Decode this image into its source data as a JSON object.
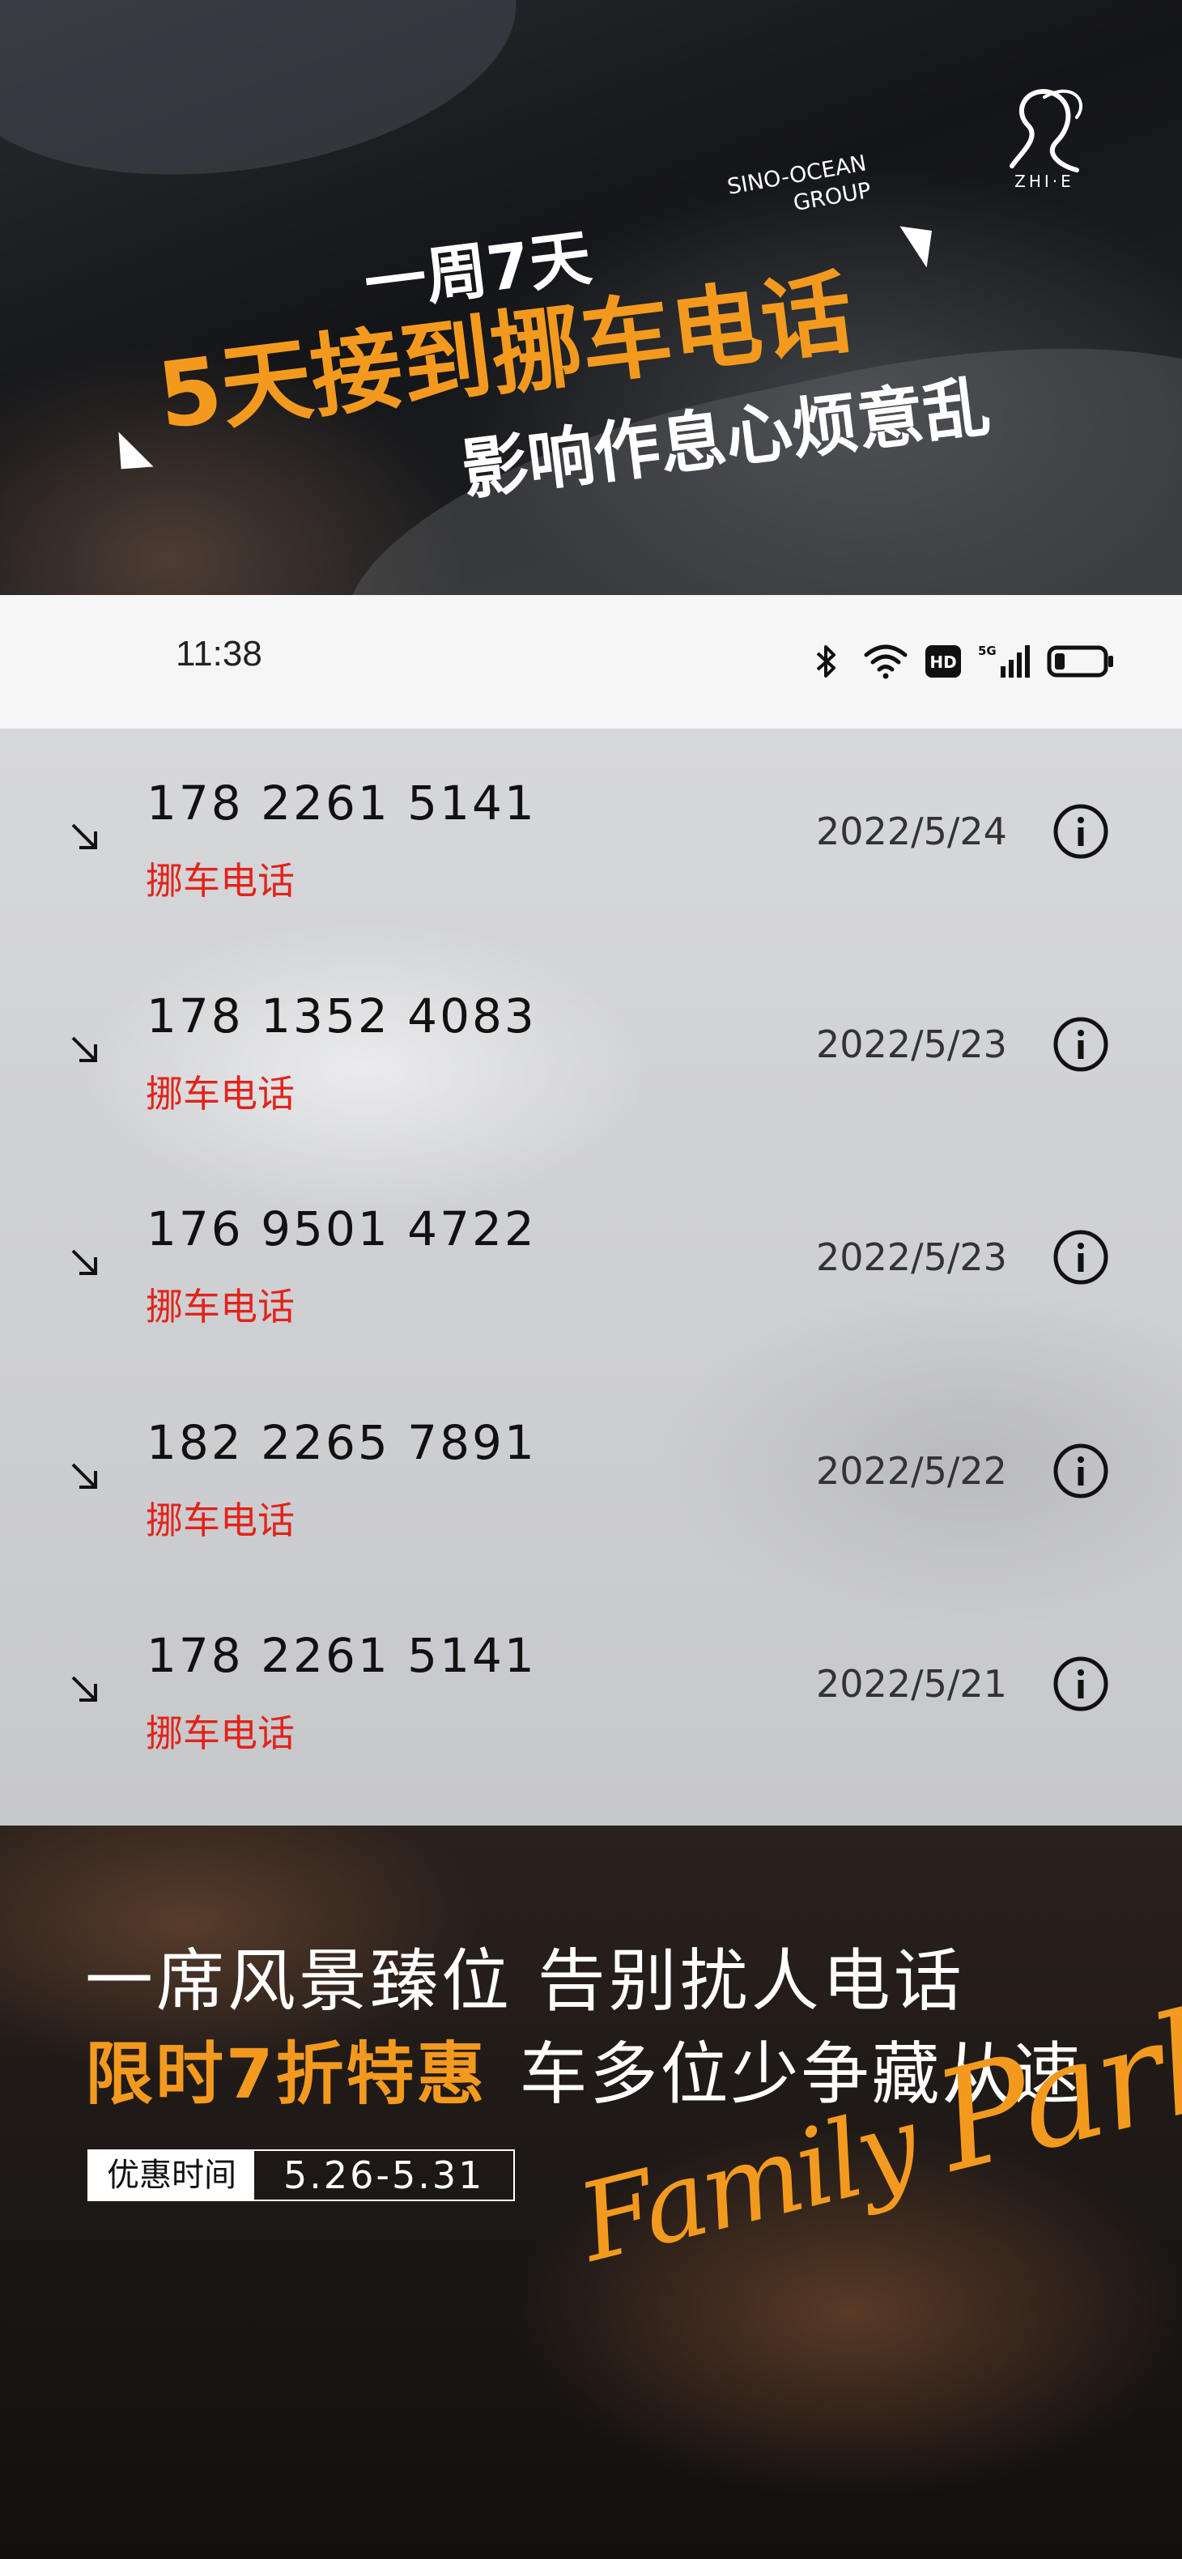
{
  "banner": {
    "logo_text": "ZHI·E",
    "sino_line1": "SINO-OCEAN",
    "sino_line2": "GROUP",
    "headline1": "一周7天",
    "headline2": "5天接到挪车电话",
    "headline3": "影响作息心烦意乱"
  },
  "status_bar": {
    "time": "11:38",
    "icons": [
      "bluetooth-icon",
      "wifi-icon",
      "hd-icon",
      "5g-signal-icon",
      "battery-icon"
    ]
  },
  "calls": [
    {
      "number": "178 2261 5141",
      "tag": "挪车电话",
      "date": "2022/5/24"
    },
    {
      "number": "178 1352 4083",
      "tag": "挪车电话",
      "date": "2022/5/23"
    },
    {
      "number": "176 9501 4722",
      "tag": "挪车电话",
      "date": "2022/5/23"
    },
    {
      "number": "182 2265 7891",
      "tag": "挪车电话",
      "date": "2022/5/22"
    },
    {
      "number": "178 2261 5141",
      "tag": "挪车电话",
      "date": "2022/5/21"
    }
  ],
  "promo": {
    "line1": "一席风景臻位 告别扰人电话",
    "line2_highlight": "限时7折特惠",
    "line2_rest": "车多位少争藏从速",
    "badge_label": "优惠时间",
    "badge_value": "5.26-5.31",
    "script_text1": "Family ",
    "script_text2": "Park"
  },
  "colors": {
    "accent_orange": "#f39a1e",
    "tag_red": "#e2231a"
  }
}
